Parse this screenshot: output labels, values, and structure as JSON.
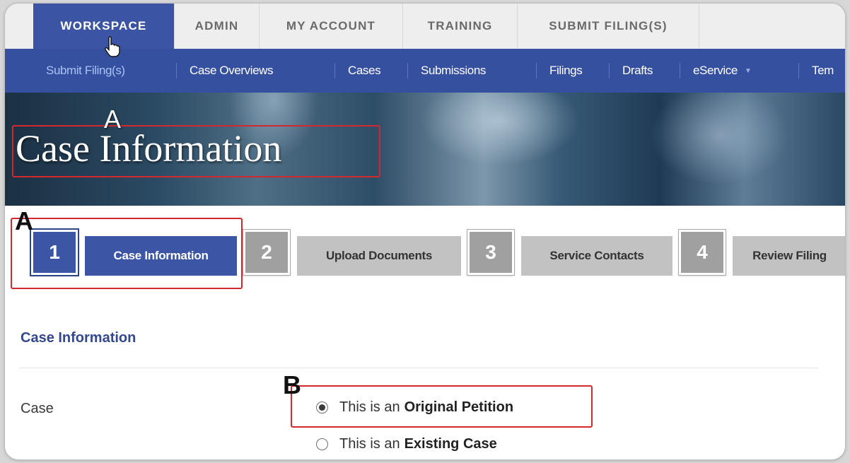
{
  "top_tabs": [
    {
      "label": "WORKSPACE",
      "active": true
    },
    {
      "label": "ADMIN",
      "active": false
    },
    {
      "label": "MY ACCOUNT",
      "active": false
    },
    {
      "label": "TRAINING",
      "active": false
    },
    {
      "label": "SUBMIT FILING(S)",
      "active": false
    }
  ],
  "sub_nav": [
    {
      "label": "Submit Filing(s)",
      "active": true
    },
    {
      "label": "Case Overviews"
    },
    {
      "label": "Cases"
    },
    {
      "label": "Submissions"
    },
    {
      "label": "Filings"
    },
    {
      "label": "Drafts"
    },
    {
      "label": "eService",
      "icon": "dropdown-caret-icon"
    },
    {
      "label": "Tem"
    }
  ],
  "banner": {
    "title": "Case Information"
  },
  "annotations": {
    "a": "A",
    "b": "B"
  },
  "steps": [
    {
      "number": "1",
      "label": "Case Information",
      "active": true
    },
    {
      "number": "2",
      "label": "Upload Documents",
      "active": false
    },
    {
      "number": "3",
      "label": "Service Contacts",
      "active": false
    },
    {
      "number": "4",
      "label": "Review Filing",
      "active": false
    }
  ],
  "form": {
    "section_title": "Case Information",
    "case_label": "Case",
    "options": [
      {
        "prefix": "This is an",
        "emphasis": "Original Petition",
        "selected": true
      },
      {
        "prefix": "This is an",
        "emphasis": "Existing Case",
        "selected": false
      }
    ]
  },
  "colors": {
    "nav_blue": "#3650a0",
    "active_tab": "#3b54a3",
    "annotation_red": "#d3282d",
    "step_gray": "#a0a0a0"
  }
}
